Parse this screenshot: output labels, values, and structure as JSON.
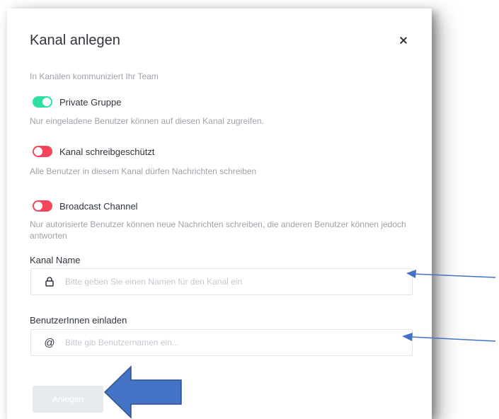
{
  "dialog": {
    "title": "Kanal anlegen",
    "subtitle": "In Kanälen kommuniziert Ihr Team"
  },
  "options": [
    {
      "label": "Private Gruppe",
      "enabled": true,
      "description": "Nur eingeladene Benutzer können auf diesen Kanal zugreifen."
    },
    {
      "label": "Kanal schreibgeschützt",
      "enabled": false,
      "description": "Alle Benutzer in diesem Kanal dürfen Nachrichten schreiben"
    },
    {
      "label": "Broadcast Channel",
      "enabled": false,
      "description": "Nur autorisierte Benutzer können neue Nachrichten schreiben, die anderen Benutzer können jedoch antworten"
    }
  ],
  "channel_name": {
    "label": "Kanal Name",
    "value": "",
    "placeholder": "Bitte geben Sie einen Namen für den Kanal ein",
    "icon": "lock-icon"
  },
  "invite_users": {
    "label": "BenutzerInnen einladen",
    "value": "",
    "placeholder": "Bitte gib Benutzernamen ein...",
    "icon": "at-icon"
  },
  "create_button": {
    "label": "Anlegen",
    "enabled": false
  },
  "colors": {
    "toggle_on": "#2de0a5",
    "toggle_off": "#f5455c",
    "annotation_arrow": "#4472c4"
  }
}
